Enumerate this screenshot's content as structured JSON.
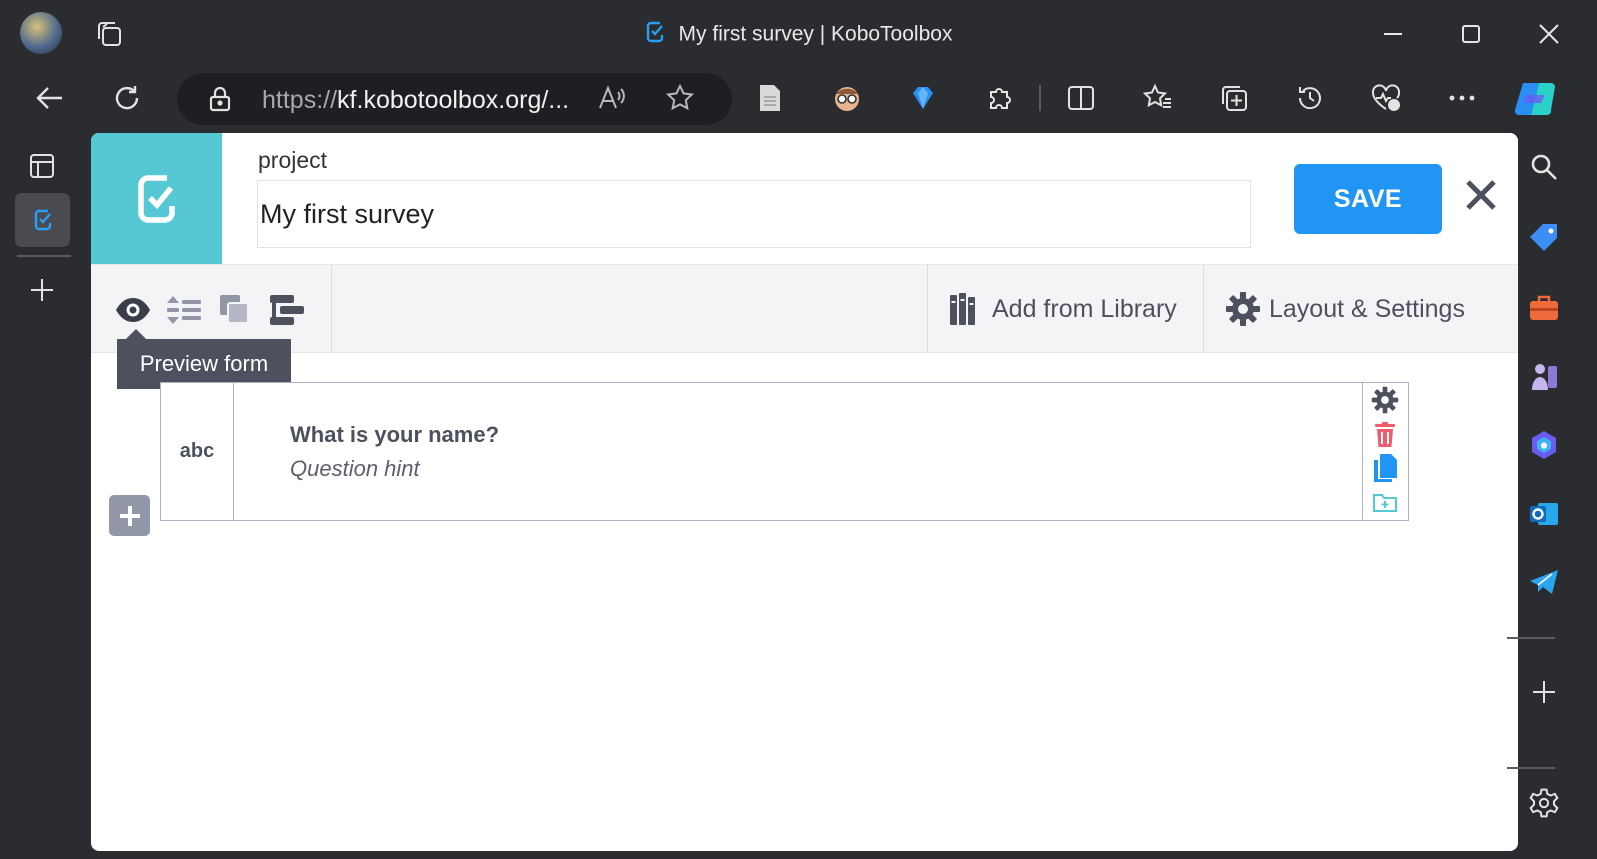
{
  "window": {
    "title": "My first survey | KoboToolbox",
    "controls": [
      "minimize-icon",
      "maximize-icon",
      "close-icon"
    ]
  },
  "address_bar": {
    "url_prefix": "https://",
    "url_domain": "kf.kobotoolbox.org/..."
  },
  "toolbar_icons": [
    "read-aloud-icon",
    "favorite-star-icon",
    "document-icon",
    "extension-face-icon",
    "diamond-icon",
    "extensions-icon",
    "split-screen-icon",
    "favorites-icon",
    "collections-icon",
    "history-icon",
    "performance-icon",
    "more-icon",
    "copilot-icon"
  ],
  "form_builder": {
    "project_label": "project",
    "project_name": "My first survey",
    "save_label": "SAVE",
    "add_from_library_label": "Add from Library",
    "layout_settings_label": "Layout & Settings",
    "tooltip": "Preview form",
    "question": {
      "type_label": "abc",
      "label": "What is your name?",
      "hint": "Question hint"
    }
  },
  "colors": {
    "logo_bg": "#55c8d3",
    "save_button": "#2095f3",
    "delete_icon": "#f05b6d",
    "copy_icon": "#2095f3",
    "icon_gray": "#4d515e"
  }
}
